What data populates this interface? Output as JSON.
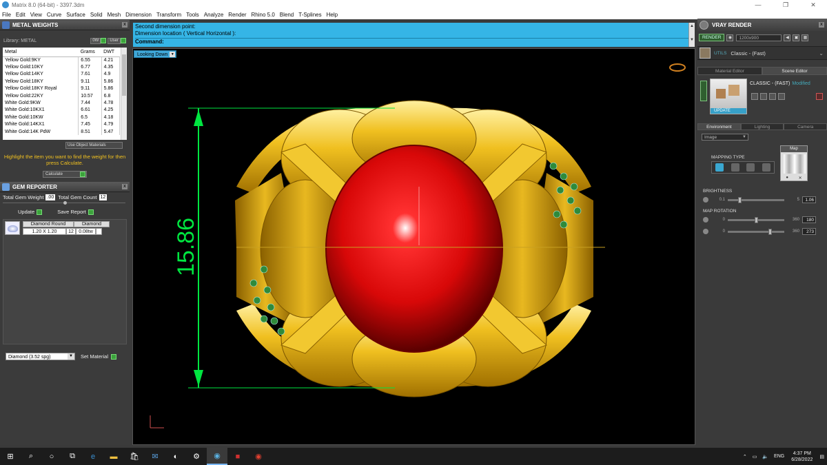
{
  "window": {
    "title": "Matrix 8.0 (64-bit) - 3397.3dm",
    "controls": [
      "—",
      "❐",
      "✕"
    ]
  },
  "menu": [
    "File",
    "Edit",
    "View",
    "Curve",
    "Surface",
    "Solid",
    "Mesh",
    "Dimension",
    "Transform",
    "Tools",
    "Analyze",
    "Render",
    "Rhino 5.0",
    "Blend",
    "T-Splines",
    "Help"
  ],
  "metal_weights": {
    "title": "METAL WEIGHTS",
    "library_label": "Library: METAL",
    "btn_0w": "0W",
    "btn_user": "User",
    "columns": [
      "Metal",
      "Grams",
      "DWT"
    ],
    "rows": [
      [
        "Yellow Gold:9KY",
        "6.55",
        "4.21"
      ],
      [
        "Yellow Gold:10KY",
        "6.77",
        "4.35"
      ],
      [
        "Yellow Gold:14KY",
        "7.61",
        "4.9"
      ],
      [
        "Yellow Gold:18KY",
        "9.11",
        "5.86"
      ],
      [
        "Yellow Gold:18KY Royal",
        "9.11",
        "5.86"
      ],
      [
        "Yellow Gold:22KY",
        "10.57",
        "6.8"
      ],
      [
        "White Gold:9KW",
        "7.44",
        "4.78"
      ],
      [
        "White Gold:10KX1",
        "6.61",
        "4.25"
      ],
      [
        "White Gold:10KW",
        "6.5",
        "4.18"
      ],
      [
        "White Gold:14KX1",
        "7.45",
        "4.79"
      ],
      [
        "White Gold:14K PdW",
        "8.51",
        "5.47"
      ]
    ],
    "use_object_materials": "Use Object Materials",
    "hint": "Highlight the item you want to find the weight for then press Calculate.",
    "calculate": "Calculate"
  },
  "gem_reporter": {
    "title": "GEM REPORTER",
    "total_weight_label": "Total Gem Weight",
    "total_weight_value": ".00",
    "total_count_label": "Total Gem Count",
    "total_count_value": "12",
    "update": "Update",
    "save_report": "Save Report",
    "head": [
      "Diamond Round",
      "Diamond"
    ],
    "row": {
      "size": "1.20 X 1.20",
      "count": "12",
      "weight": "0.08tw"
    },
    "material_select": "Diamond    (3.52 spg)",
    "set_material": "Set Material"
  },
  "command": {
    "line1": "Second dimension point:",
    "line2": "Dimension location ( Vertical  Horizontal ):",
    "prompt": "Command:"
  },
  "viewport": {
    "view_select": "Looking Down",
    "dimension_value": "15.86"
  },
  "vray": {
    "title": "VRAY RENDER",
    "render_btn": "RENDER",
    "resolution": "1200x900",
    "preset_tag": "UTILS",
    "preset_name": "Classic - (Fast)",
    "tabs_top": [
      "Material Editor",
      "Scene Editor"
    ],
    "scene_name": "CLASSIC - (FAST)",
    "scene_modified": "Modified",
    "update_label": "UPDATE",
    "tabs_env": [
      "Environment",
      "Lighting",
      "Camera"
    ],
    "env_select": "Image",
    "mapping_type": "MAPPING TYPE",
    "map_label": "Map",
    "brightness_label": "BRIGHTNESS",
    "brightness": {
      "min": "0.1",
      "max": "5",
      "value": "1.06",
      "fraction": 0.2
    },
    "map_rotation_label": "MAP ROTATION",
    "rot1": {
      "min": "0",
      "max": "360",
      "value": "180",
      "fraction": 0.5
    },
    "rot2": {
      "min": "0",
      "max": "360",
      "value": "273",
      "fraction": 0.76
    }
  },
  "taskbar": {
    "lang": "ENG",
    "time": "4:37 PM",
    "date": "6/28/2022"
  },
  "colors": {
    "command_bg": "#35b5e6",
    "dimension_green": "#00e640",
    "gold": "#e8b820",
    "gem_red": "#e01010"
  }
}
